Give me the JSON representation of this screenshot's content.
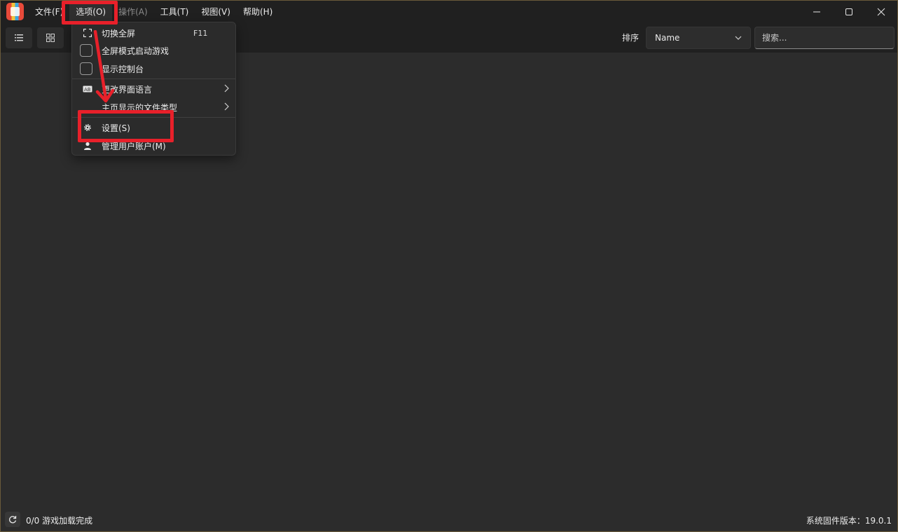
{
  "menubar": {
    "items": [
      "文件(F)",
      "选项(O)",
      "操作(A)",
      "工具(T)",
      "视图(V)",
      "帮助(H)"
    ]
  },
  "toolbar": {
    "sort_label": "排序",
    "sort_value": "Name",
    "search_placeholder": "搜索..."
  },
  "options_menu": {
    "fullscreen": {
      "label": "切换全屏",
      "shortcut": "F11"
    },
    "fullscreen_launch": "全屏模式启动游戏",
    "show_console": "显示控制台",
    "ui_language": "更改界面语言",
    "home_file_types": "主页显示的文件类型",
    "settings": "设置(S)",
    "manage_users": "管理用户账户(M)"
  },
  "status": {
    "games_loaded": "0/0 游戏加载完成",
    "firmware": "系统固件版本：19.0.1"
  },
  "colors": {
    "annotation": "#e8202a",
    "background": "#2c2c2c",
    "titlebar": "#202020"
  }
}
